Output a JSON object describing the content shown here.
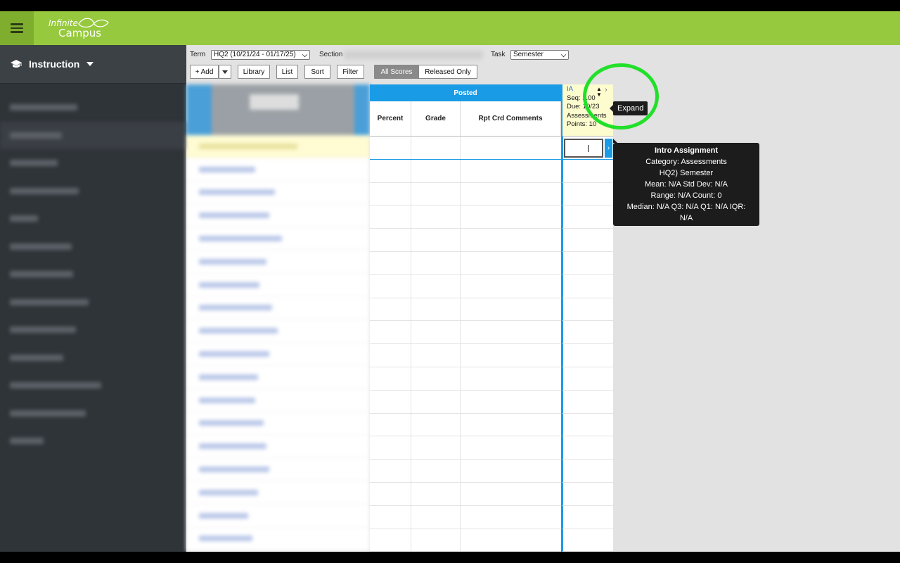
{
  "app": {
    "logo_top": "Infinite",
    "logo_bottom": "Campus",
    "colors": {
      "brand_green": "#96c93d",
      "accent_blue": "#1a9be6",
      "highlight_ring": "#22e02a"
    }
  },
  "sidebar": {
    "title": "Instruction",
    "icon": "graduation-cap-icon"
  },
  "toolbar": {
    "term_label": "Term",
    "term_value": "HQ2 (10/21/24 - 01/17/25)",
    "section_label": "Section",
    "task_label": "Task",
    "task_value": "Semester",
    "add_label": "+ Add",
    "library_label": "Library",
    "list_label": "List",
    "sort_label": "Sort",
    "filter_label": "Filter",
    "all_scores_label": "All Scores",
    "released_only_label": "Released Only"
  },
  "grid": {
    "posted_label": "Posted",
    "columns": [
      "Percent",
      "Grade",
      "Rpt Crd Comments"
    ]
  },
  "assignment": {
    "code": "IA",
    "seq": "Seq: 1.00",
    "due": "Due: 10/23",
    "category": "Assessments",
    "points": "Points: 10",
    "score_value": ""
  },
  "tooltips": {
    "expand": "Expand",
    "info_title": "Intro Assignment",
    "info_lines": [
      "Category: Assessments",
      "HQ2) Semester",
      "Mean: N/A Std Dev: N/A",
      "Range: N/A Count: 0",
      "Median: N/A Q3: N/A Q1: N/A IQR:",
      "N/A"
    ]
  }
}
